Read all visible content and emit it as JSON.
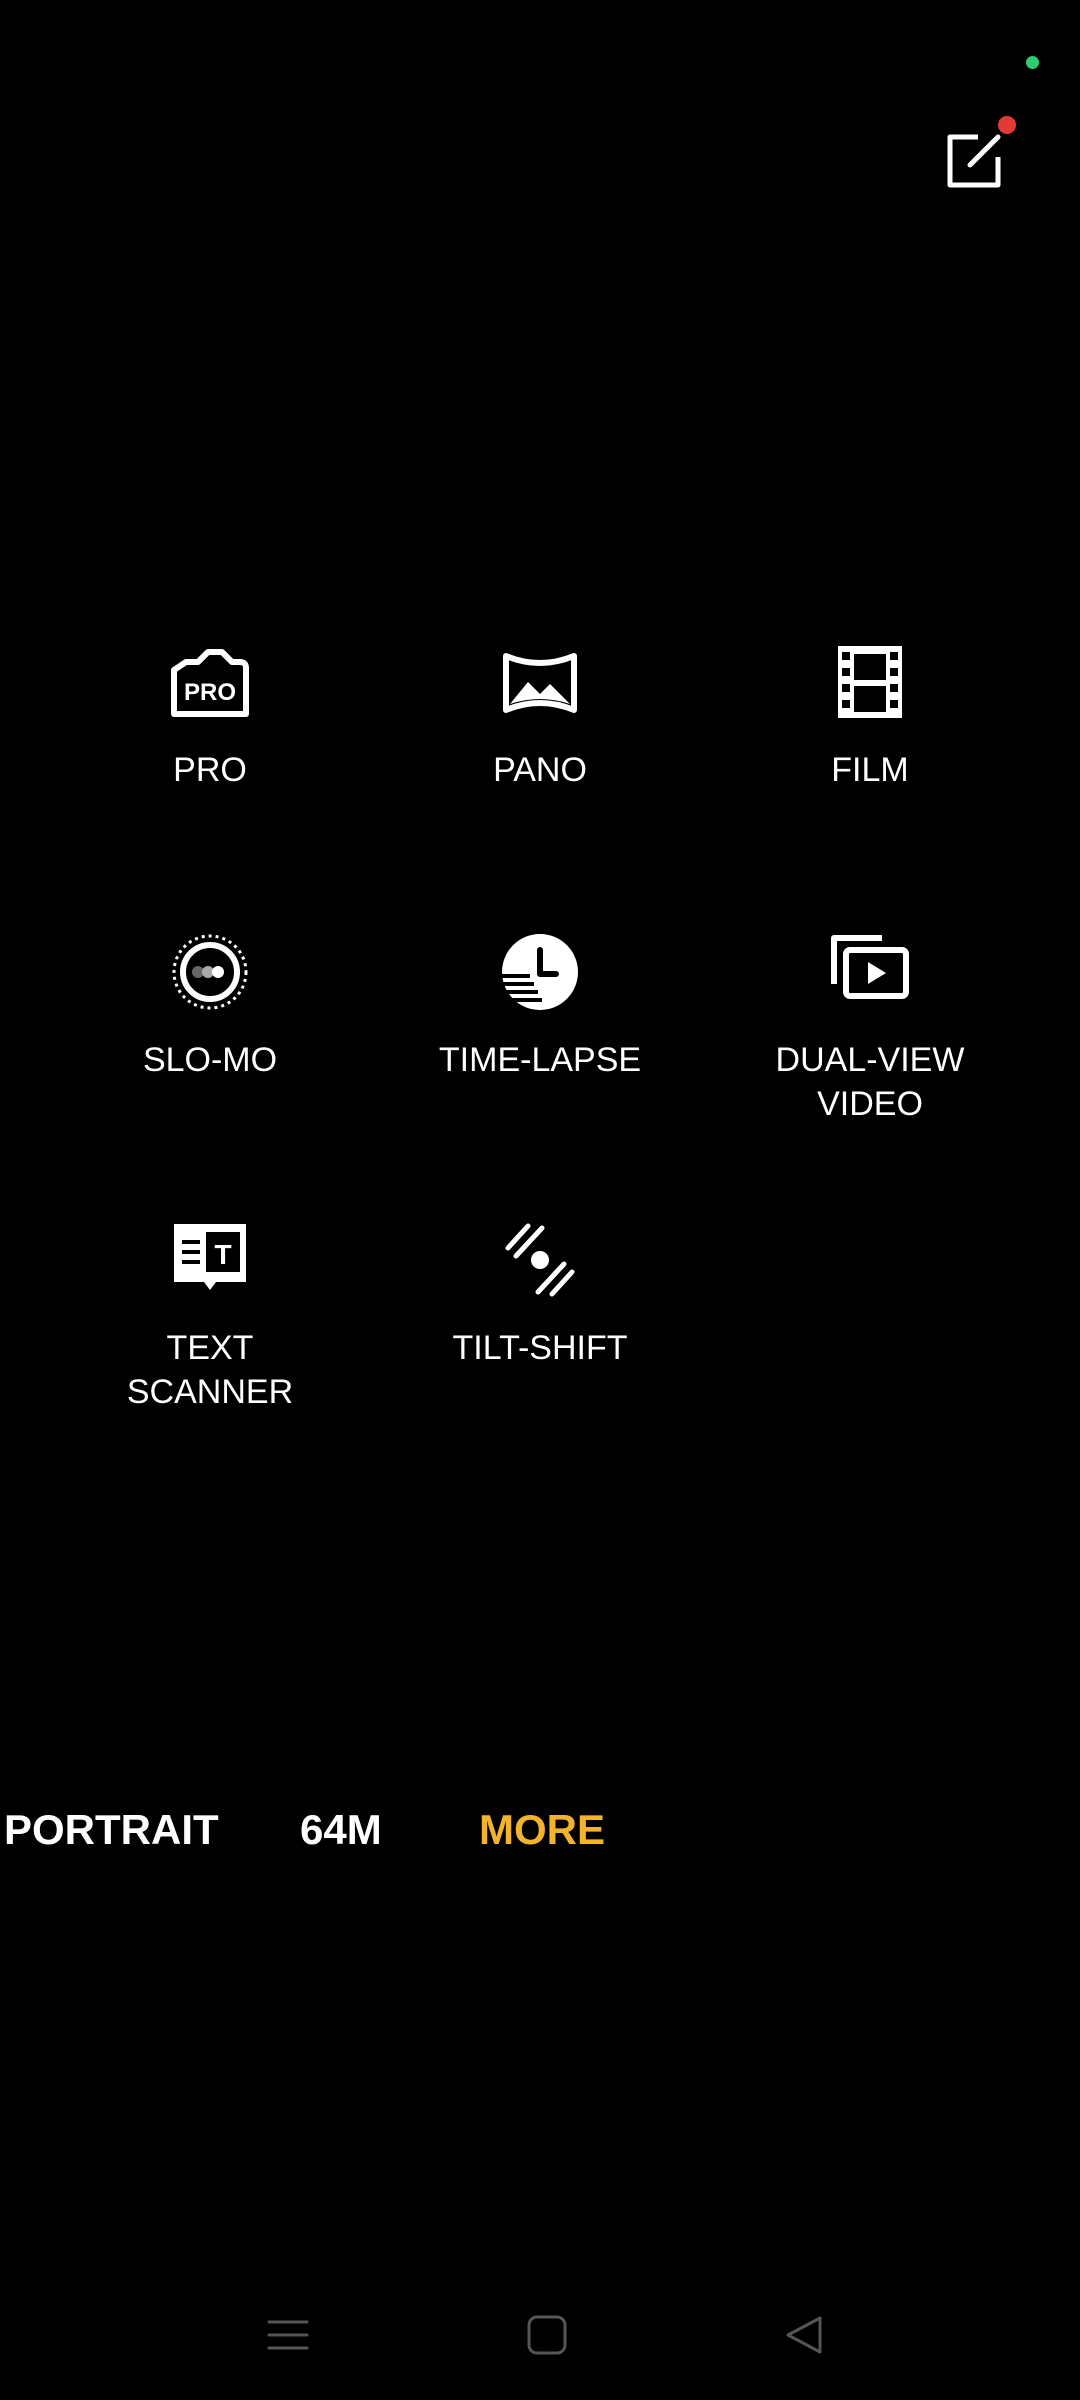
{
  "modes": {
    "pro": {
      "label": "PRO",
      "icon": "pro-icon"
    },
    "pano": {
      "label": "PANO",
      "icon": "pano-icon"
    },
    "film": {
      "label": "FILM",
      "icon": "film-icon"
    },
    "slomo": {
      "label": "SLO-MO",
      "icon": "slow-motion-icon"
    },
    "timelapse": {
      "label": "TIME-LAPSE",
      "icon": "clock-icon"
    },
    "dualview": {
      "label": "DUAL-VIEW\nVIDEO",
      "icon": "dual-view-icon"
    },
    "textscanner": {
      "label": "TEXT\nSCANNER",
      "icon": "text-scanner-icon"
    },
    "tiltshift": {
      "label": "TILT-SHIFT",
      "icon": "tilt-shift-icon"
    }
  },
  "mode_bar": {
    "portrait": "PORTRAIT",
    "mp64": "64M",
    "more": "MORE",
    "active_color": "#f3b42c"
  },
  "status": {
    "indicator_color": "#2ecc71",
    "badge_color": "#e53935"
  },
  "nav": {
    "menu_icon": "menu-icon",
    "home_icon": "home-icon",
    "back_icon": "back-icon"
  }
}
